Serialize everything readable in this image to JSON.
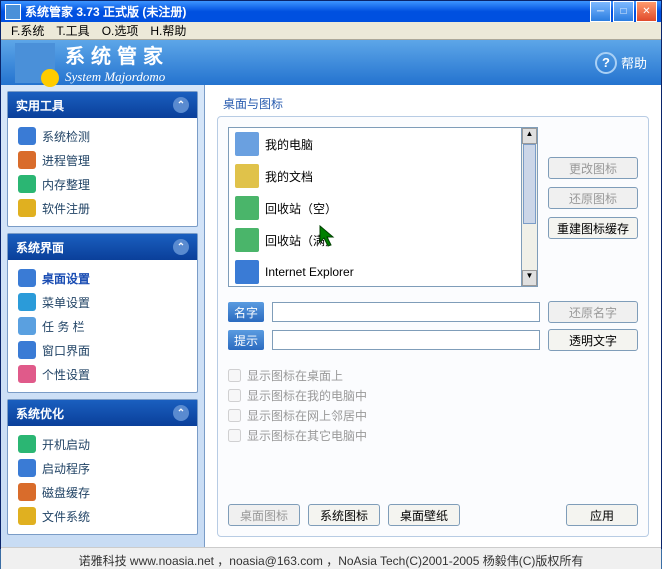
{
  "window": {
    "title": "系统管家 3.73 正式版 (未注册)"
  },
  "menu": {
    "file": "F.系统",
    "tools": "T.工具",
    "options": "O.选项",
    "help": "H.帮助"
  },
  "header": {
    "title": "系统管家",
    "subtitle": "System Majordomo",
    "help": "帮助"
  },
  "sidebar": {
    "groups": [
      {
        "title": "实用工具",
        "items": [
          {
            "label": "系统检测",
            "color": "#3a7bd5"
          },
          {
            "label": "进程管理",
            "color": "#d96c2b"
          },
          {
            "label": "内存整理",
            "color": "#2bb673"
          },
          {
            "label": "软件注册",
            "color": "#e0b020"
          }
        ]
      },
      {
        "title": "系统界面",
        "items": [
          {
            "label": "桌面设置",
            "color": "#3a7bd5",
            "active": true
          },
          {
            "label": "菜单设置",
            "color": "#2b9bd9"
          },
          {
            "label": "任 务 栏",
            "color": "#5aa0e0"
          },
          {
            "label": "窗口界面",
            "color": "#3a7bd5"
          },
          {
            "label": "个性设置",
            "color": "#e05a8a"
          }
        ]
      },
      {
        "title": "系统优化",
        "items": [
          {
            "label": "开机启动",
            "color": "#2bb673"
          },
          {
            "label": "启动程序",
            "color": "#3a7bd5"
          },
          {
            "label": "磁盘缓存",
            "color": "#d96c2b"
          },
          {
            "label": "文件系统",
            "color": "#e0b020"
          }
        ]
      }
    ]
  },
  "main": {
    "title": "桌面与图标",
    "list": [
      {
        "label": "我的电脑",
        "color": "#6aa0e0"
      },
      {
        "label": "我的文档",
        "color": "#e0c24a"
      },
      {
        "label": "回收站（空）",
        "color": "#4ab56a"
      },
      {
        "label": "回收站（满）",
        "color": "#4ab56a"
      },
      {
        "label": "Internet Explorer",
        "color": "#3a7bd5"
      }
    ],
    "buttons": {
      "changeIcon": "更改图标",
      "restoreIcon": "还原图标",
      "rebuildCache": "重建图标缓存",
      "restoreName": "还原名字",
      "transparentText": "透明文字",
      "apply": "应用",
      "tabDesktopIcon": "桌面图标",
      "tabSystemIcon": "系统图标",
      "tabWallpaper": "桌面壁纸"
    },
    "fields": {
      "name": "名字",
      "hint": "提示"
    },
    "checks": {
      "c1": "显示图标在桌面上",
      "c2": "显示图标在我的电脑中",
      "c3": "显示图标在网上邻居中",
      "c4": "显示图标在其它电脑中"
    }
  },
  "footer": "诺雅科技 www.noasia.net ，noasia@163.com ，NoAsia Tech(C)2001-2005  杨毅伟(C)版权所有"
}
